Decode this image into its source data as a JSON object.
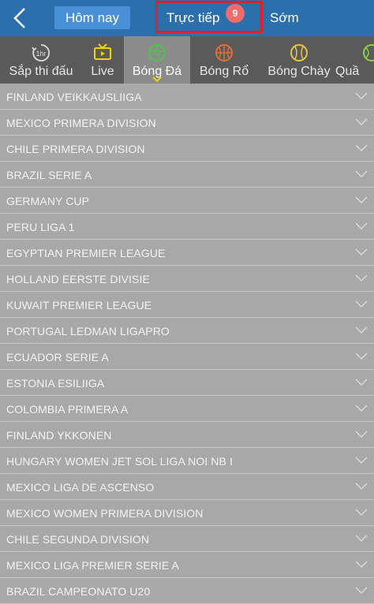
{
  "header": {
    "today_label": "Hôm nay",
    "live_label": "Trực tiếp",
    "live_count": "9",
    "early_label": "Sớm"
  },
  "tabs": [
    {
      "label": "Sắp thi đấu",
      "icon": "clock-1hr-icon"
    },
    {
      "label": "Live",
      "icon": "tv-icon"
    },
    {
      "label": "Bóng Đá",
      "icon": "soccer-ball-icon",
      "active": true
    },
    {
      "label": "Bóng Rổ",
      "icon": "basketball-icon"
    },
    {
      "label": "Bóng Chày",
      "icon": "baseball-icon"
    },
    {
      "label": "Quầ",
      "icon": "tennis-ball-icon"
    }
  ],
  "leagues": [
    "FINLAND VEIKKAUSLIIGA",
    "MEXICO PRIMERA DIVISION",
    "CHILE PRIMERA DIVISION",
    "BRAZIL SERIE A",
    "GERMANY CUP",
    "PERU LIGA 1",
    "EGYPTIAN PREMIER LEAGUE",
    "HOLLAND EERSTE DIVISIE",
    "KUWAIT PREMIER LEAGUE",
    "PORTUGAL LEDMAN LIGAPRO",
    "ECUADOR SERIE A",
    "ESTONIA ESILIIGA",
    "COLOMBIA PRIMERA A",
    "FINLAND YKKONEN",
    "HUNGARY WOMEN JET SOL LIGA NOI NB I",
    "MEXICO LIGA DE ASCENSO",
    "MEXICO WOMEN PRIMERA DIVISION",
    "CHILE SEGUNDA DIVISION",
    "MEXICO LIGA PREMIER SERIE A",
    "BRAZIL CAMPEONATO U20"
  ],
  "colors": {
    "header": "#2b6fad",
    "live_border": "#e0202a",
    "badge": "#f06b6b"
  }
}
